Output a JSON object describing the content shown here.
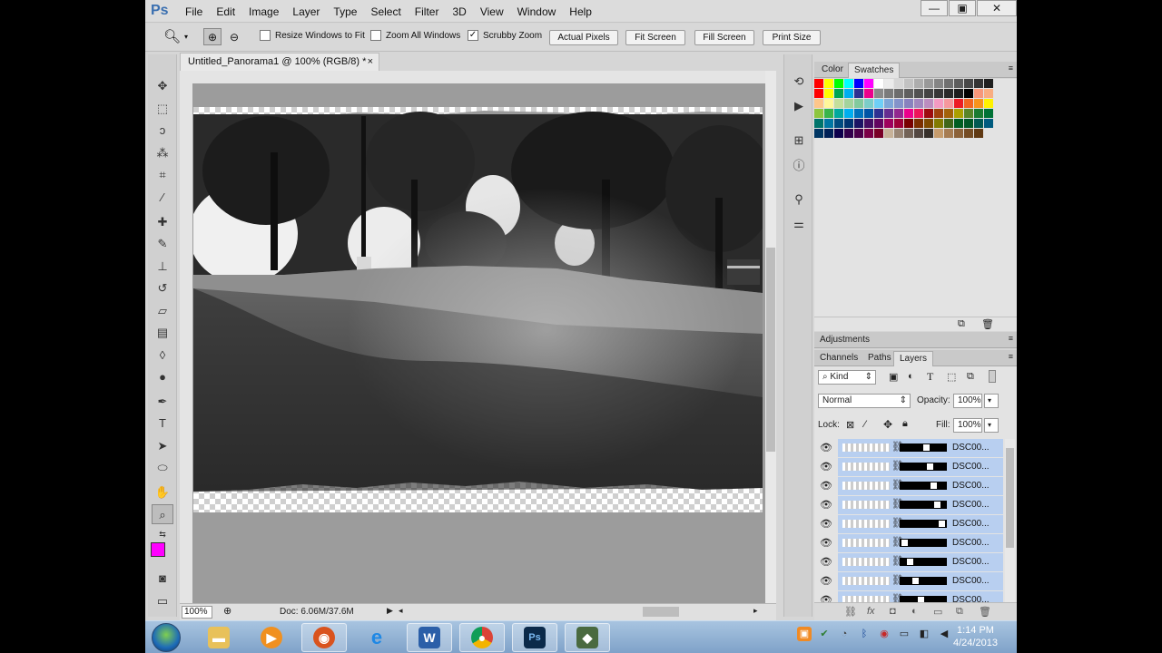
{
  "app": {
    "logo": "Ps"
  },
  "menu": [
    "File",
    "Edit",
    "Image",
    "Layer",
    "Type",
    "Select",
    "Filter",
    "3D",
    "View",
    "Window",
    "Help"
  ],
  "window_controls": {
    "minimize": "—",
    "restore": "▣",
    "close": "✕"
  },
  "options": {
    "resize_windows_label": "Resize Windows to Fit",
    "resize_windows_checked": false,
    "zoom_all_label": "Zoom All Windows",
    "zoom_all_checked": false,
    "scrubby_label": "Scrubby Zoom",
    "scrubby_checked": true,
    "actual_pixels": "Actual Pixels",
    "fit_screen": "Fit Screen",
    "fill_screen": "Fill Screen",
    "print_size": "Print Size"
  },
  "document": {
    "tab_title": "Untitled_Panorama1 @ 100% (RGB/8) *",
    "close": "×",
    "zoom": "100%",
    "doc_size": "Doc: 6.06M/37.6M"
  },
  "colors": {
    "foreground": "#ff00ff",
    "background": "#000000",
    "selection": "#b8cff0"
  },
  "panels": {
    "color_tab": "Color",
    "swatches_tab": "Swatches",
    "adjustments_tab": "Adjustments",
    "channels_tab": "Channels",
    "paths_tab": "Paths",
    "layers_tab": "Layers"
  },
  "layers": {
    "filter_kind": "Kind",
    "blend_mode": "Normal",
    "opacity_label": "Opacity:",
    "opacity": "100%",
    "lock_label": "Lock:",
    "fill_label": "Fill:",
    "fill": "100%",
    "items": [
      {
        "name": "DSC00...",
        "visible": true
      },
      {
        "name": "DSC00...",
        "visible": true
      },
      {
        "name": "DSC00...",
        "visible": true
      },
      {
        "name": "DSC00...",
        "visible": true
      },
      {
        "name": "DSC00...",
        "visible": true
      },
      {
        "name": "DSC00...",
        "visible": true
      },
      {
        "name": "DSC00...",
        "visible": true
      },
      {
        "name": "DSC00...",
        "visible": true
      },
      {
        "name": "DSC00...",
        "visible": true
      }
    ]
  },
  "swatch_colors": [
    "#ff0000",
    "#ffff00",
    "#00ff00",
    "#00ffff",
    "#0000ff",
    "#ff00ff",
    "#ffffff",
    "#ebebeb",
    "#d6d6d6",
    "#c2c2c2",
    "#adadad",
    "#999999",
    "#858585",
    "#707070",
    "#5c5c5c",
    "#474747",
    "#333333",
    "#1f1f1f",
    "#ff0000",
    "#ffff00",
    "#00a651",
    "#00aeef",
    "#2e3192",
    "#ec008c",
    "#898989",
    "#7b7b7b",
    "#6d6d6d",
    "#5f5f5f",
    "#515151",
    "#434343",
    "#363636",
    "#292929",
    "#1c1c1c",
    "#000000",
    "#f7977a",
    "#f9ad81",
    "#fdc68a",
    "#fff79a",
    "#c4df9b",
    "#a3d39c",
    "#82ca9d",
    "#7bcdc8",
    "#6ecff6",
    "#7ea7d8",
    "#8493ca",
    "#8882be",
    "#a187be",
    "#bc8dbf",
    "#f49ac2",
    "#f6989d",
    "#ed1c24",
    "#f26522",
    "#f7941d",
    "#fff200",
    "#8dc63f",
    "#39b54a",
    "#00a99d",
    "#00aeef",
    "#0072bc",
    "#0054a6",
    "#2e3192",
    "#662d91",
    "#92278f",
    "#ec008c",
    "#ed145b",
    "#9e0b0f",
    "#a0410d",
    "#a36209",
    "#aba000",
    "#598527",
    "#1a7b30",
    "#007236",
    "#00746b",
    "#0076a3",
    "#004b80",
    "#003471",
    "#1b1464",
    "#440e62",
    "#630460",
    "#9e005d",
    "#9e0039",
    "#790000",
    "#7b2e00",
    "#7d4900",
    "#827b00",
    "#406618",
    "#005e20",
    "#005826",
    "#005952",
    "#005b7f",
    "#003663",
    "#002157",
    "#0d004c",
    "#32004b",
    "#4b0049",
    "#7b0046",
    "#7a0026",
    "#c7b299",
    "#998675",
    "#736357",
    "#534741",
    "#37302a",
    "#c69c6d",
    "#a67c52",
    "#8c6239",
    "#754c24",
    "#603913"
  ],
  "taskbar": {
    "time": "1:14 PM",
    "date": "4/24/2013",
    "word_letter": "W",
    "ps_letter": "Ps"
  }
}
